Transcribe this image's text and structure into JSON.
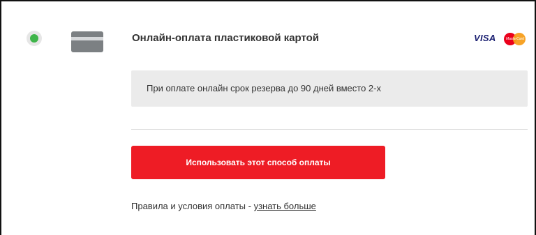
{
  "payment_option": {
    "selected": true,
    "title": "Онлайн-оплата пластиковой картой",
    "card_icon": "credit-card-icon",
    "brands": {
      "visa_label": "VISA",
      "mastercard_label": "MasterCard"
    },
    "note": "При оплате онлайн срок резерва до 90 дней вместо 2-х",
    "action_button_label": "Использовать этот способ оплаты",
    "terms_prefix": "Правила и условия оплаты - ",
    "terms_link_label": "узнать больше"
  },
  "colors": {
    "accent_red": "#ee1c25",
    "radio_green": "#3fb54a",
    "note_background": "#ebebeb",
    "visa_blue": "#1a1f71"
  }
}
